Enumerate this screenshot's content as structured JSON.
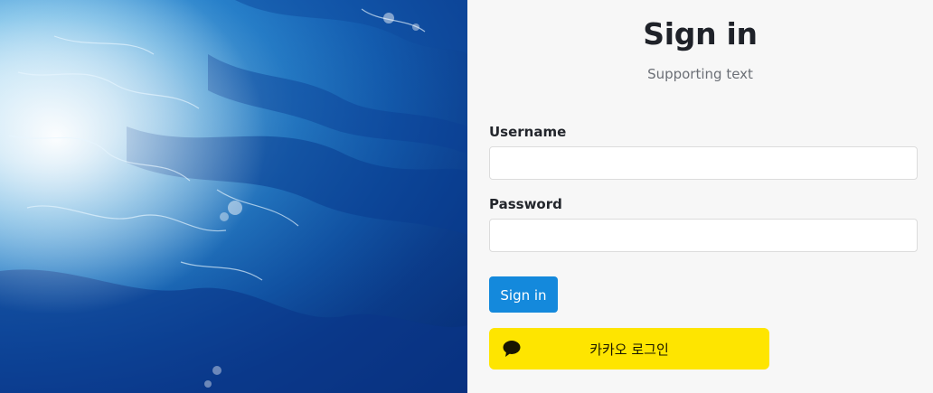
{
  "colors": {
    "accent": "#1489dc",
    "kakao_yellow": "#fee500",
    "panel_background": "#f7f7f7"
  },
  "form": {
    "title": "Sign in",
    "subtitle": "Supporting text",
    "username_label": "Username",
    "username_value": "",
    "password_label": "Password",
    "password_value": "",
    "signin_button": "Sign in",
    "kakao_button": "카카오 로그인",
    "kakao_icon": "speech-bubble-icon"
  },
  "hero": {
    "image": "ocean-waves"
  }
}
